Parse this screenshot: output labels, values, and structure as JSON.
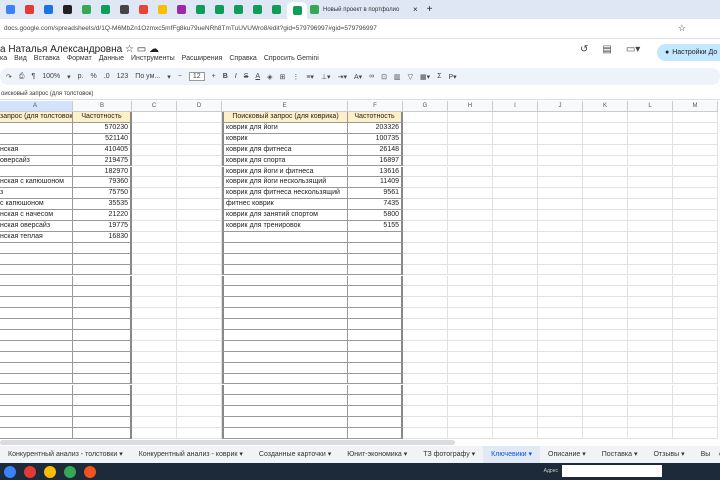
{
  "browser": {
    "tab_colors": [
      "#3b82f6",
      "#e53935",
      "#1a73e8",
      "#222222",
      "#34a853",
      "#0f9d58",
      "#444444",
      "#ea4335",
      "#fbbc04",
      "#9c27b0",
      "#0f9d58",
      "#0f9d58",
      "#0f9d58",
      "#0f9d58",
      "#0f9d58",
      "#0f9d58"
    ],
    "active_tab_title": "Новый проект в портфолио",
    "close": "×",
    "new_tab": "+",
    "url": "docs.google.com/spreadsheets/d/1Q-M6MbZn1Ozmxc5mfFg8ku79ueNRh8TmTuUVUWro8/edit?gid=579796997#gid=579796997"
  },
  "doc": {
    "title": "а Наталья Александровна",
    "share_label": "Настройки До"
  },
  "menu": [
    "ка",
    "Вид",
    "Вставка",
    "Формат",
    "Данные",
    "Инструменты",
    "Расширения",
    "Справка",
    "Спросить Gemini"
  ],
  "toolbar": {
    "zoom": "100%",
    "font": "По ум...",
    "font_size": "12",
    "items": [
      "↶",
      "↷",
      "⎙",
      "₽",
      "%",
      ".0",
      "123",
      "B",
      "I",
      "S",
      "A"
    ]
  },
  "formula": "оисковый запрос (для толстовок)",
  "columns": [
    "A",
    "B",
    "C",
    "D",
    "E",
    "F",
    "G",
    "H",
    "I",
    "J",
    "K",
    "L",
    "M"
  ],
  "table1": {
    "headers": [
      "запрос (для толстовок)",
      "Частотность"
    ],
    "rows": [
      [
        "",
        "570230"
      ],
      [
        "",
        "521140"
      ],
      [
        "нская",
        "410405"
      ],
      [
        " оверсайз",
        "219475"
      ],
      [
        "",
        "182970"
      ],
      [
        "нская с капюшоном",
        "79360"
      ],
      [
        "з",
        "75750"
      ],
      [
        " с капюшоном",
        "35535"
      ],
      [
        "нская с начесом",
        "21220"
      ],
      [
        "нская оверсайз",
        "19775"
      ],
      [
        "нская теплая",
        "16830"
      ]
    ]
  },
  "table2": {
    "headers": [
      "Поисковый запрос (для коврика)",
      "Частотность"
    ],
    "rows": [
      [
        "коврик для йоги",
        "203326"
      ],
      [
        "коврик",
        "100735"
      ],
      [
        "коврик для фитнеса",
        "26148"
      ],
      [
        "коврик для спорта",
        "16897"
      ],
      [
        "коврик для йоги и фитнеса",
        "13616"
      ],
      [
        "коврик для йоги нескользящий",
        "11409"
      ],
      [
        "коврик для фитнеса нескользящий",
        "9561"
      ],
      [
        "фитнес коврик",
        "7435"
      ],
      [
        "коврик для занятий спортом",
        "5800"
      ],
      [
        "коврик для тренировок",
        "5155"
      ]
    ]
  },
  "sheets": [
    {
      "label": "Конкурентный анализ - толстовки"
    },
    {
      "label": "Конкурентный анализ - коврик"
    },
    {
      "label": "Созданные карточки"
    },
    {
      "label": "Юнит-экономика"
    },
    {
      "label": "ТЗ фотографу"
    },
    {
      "label": "Ключевики",
      "active": true
    },
    {
      "label": "Описание"
    },
    {
      "label": "Поставка"
    },
    {
      "label": "Отзывы"
    },
    {
      "label": "Вы"
    }
  ],
  "taskbar": {
    "address_label": "Адрес",
    "icon_colors": [
      "#3b82f6",
      "#e53935",
      "#fbbc04",
      "#34a853",
      "#f4511e"
    ]
  }
}
